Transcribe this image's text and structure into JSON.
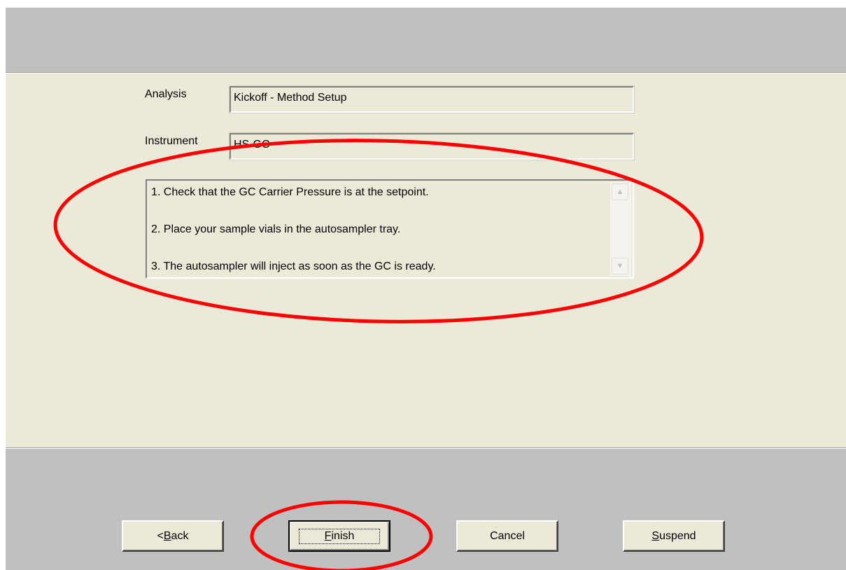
{
  "form": {
    "analysis_label": "Analysis",
    "analysis_value": "Kickoff - Method Setup",
    "instrument_label": "Instrument",
    "instrument_value": "HS-GC"
  },
  "instructions": [
    "1. Check that the GC Carrier Pressure is at the setpoint.",
    "2. Place your sample vials in the autosampler tray.",
    "3. The autosampler will inject as soon as the GC is ready."
  ],
  "buttons": {
    "back": {
      "mnemonic": "B",
      "rest": "ack",
      "prefix": "<"
    },
    "finish": {
      "mnemonic": "F",
      "rest": "inish"
    },
    "cancel": "Cancel",
    "suspend": {
      "mnemonic": "S",
      "rest": "uspend"
    }
  },
  "colors": {
    "panel": "#ece9d8",
    "band": "#c0c0c0",
    "annotation": "#ff0000"
  }
}
